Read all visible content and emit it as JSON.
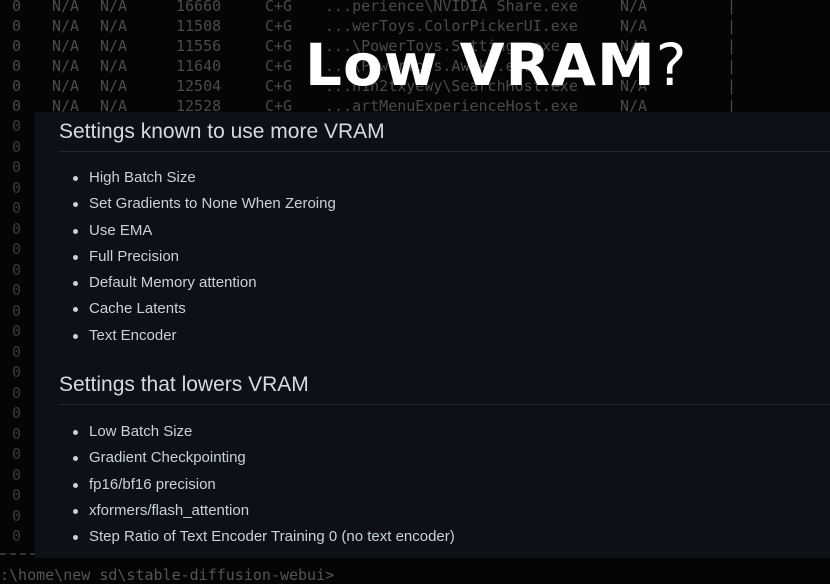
{
  "title": {
    "main": "Low VRAM",
    "mark": "?"
  },
  "terminal": {
    "rows": [
      [
        "0",
        "N/A",
        "N/A",
        "16660",
        "C+G",
        "...perience\\NVIDIA Share.exe",
        "N/A"
      ],
      [
        "0",
        "N/A",
        "N/A",
        "11508",
        "C+G",
        "...werToys.ColorPickerUI.exe",
        "N/A"
      ],
      [
        "0",
        "N/A",
        "N/A",
        "11556",
        "C+G",
        "...\\PowerToys.Settings.exe",
        "N/A"
      ],
      [
        "0",
        "N/A",
        "N/A",
        "11640",
        "C+G",
        "...\\PowerToys.Awake.exe",
        "N/A"
      ],
      [
        "0",
        "N/A",
        "N/A",
        "12504",
        "C+G",
        "...n1h2txyewy\\SearchHost.exe",
        "N/A"
      ],
      [
        "0",
        "N/A",
        "N/A",
        "12528",
        "C+G",
        "...artMenuExperienceHost.exe",
        "N/A"
      ]
    ],
    "prompt": ":\\home\\new sd\\stable-diffusion-webui>"
  },
  "panel": {
    "more": {
      "heading": "Settings known to use more VRAM",
      "items": [
        "High Batch Size",
        "Set Gradients to None When Zeroing",
        "Use EMA",
        "Full Precision",
        "Default Memory attention",
        "Cache Latents",
        "Text Encoder"
      ]
    },
    "less": {
      "heading": "Settings that lowers VRAM",
      "items": [
        "Low Batch Size",
        "Gradient Checkpointing",
        "fp16/bf16 precision",
        "xformers/flash_attention",
        "Step Ratio of Text Encoder Training 0 (no text encoder)"
      ]
    }
  }
}
